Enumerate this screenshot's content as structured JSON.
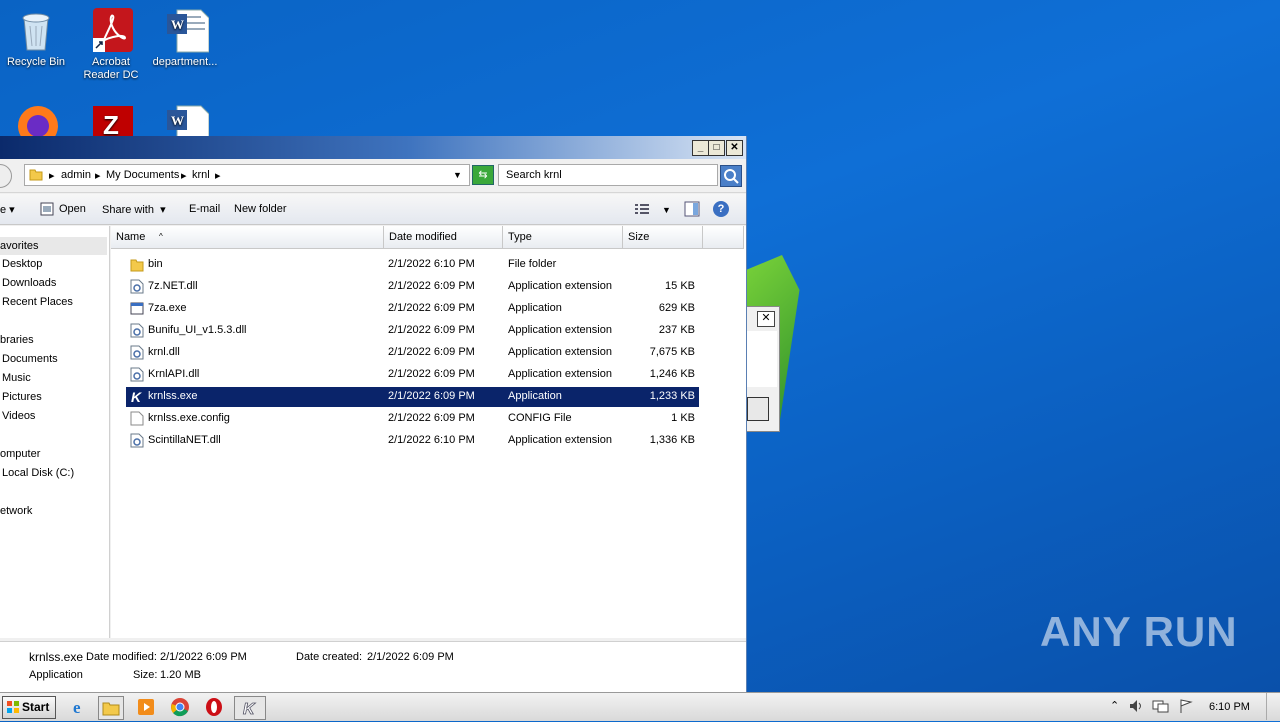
{
  "desktop": {
    "icons": [
      {
        "label": "Recycle Bin"
      },
      {
        "label": "Acrobat Reader DC"
      },
      {
        "label": "department..."
      },
      {
        "label": ""
      },
      {
        "label": ""
      },
      {
        "label": ""
      }
    ],
    "watermark": "ANY RUN"
  },
  "explorer": {
    "breadcrumb": [
      "admin",
      "My Documents",
      "krnl"
    ],
    "search_placeholder": "Search krnl",
    "toolbar": {
      "organize_label": "e",
      "open_label": "Open",
      "share_label": "Share with",
      "email_label": "E-mail",
      "new_folder_label": "New folder"
    },
    "nav": {
      "favorites": "avorites",
      "desktop": "Desktop",
      "downloads": "Downloads",
      "recent": "Recent Places",
      "libraries": "braries",
      "documents": "Documents",
      "music": "Music",
      "pictures": "Pictures",
      "videos": "Videos",
      "computer": "omputer",
      "local_disk": "Local Disk (C:)",
      "network": "etwork"
    },
    "columns": {
      "name": "Name",
      "date": "Date modified",
      "type": "Type",
      "size": "Size"
    },
    "files": [
      {
        "name": "bin",
        "date": "2/1/2022 6:10 PM",
        "type": "File folder",
        "size": "",
        "icon": "folder-icon"
      },
      {
        "name": "7z.NET.dll",
        "date": "2/1/2022 6:09 PM",
        "type": "Application extension",
        "size": "15 KB",
        "icon": "dll-icon"
      },
      {
        "name": "7za.exe",
        "date": "2/1/2022 6:09 PM",
        "type": "Application",
        "size": "629 KB",
        "icon": "exe-icon"
      },
      {
        "name": "Bunifu_UI_v1.5.3.dll",
        "date": "2/1/2022 6:09 PM",
        "type": "Application extension",
        "size": "237 KB",
        "icon": "dll-icon"
      },
      {
        "name": "krnl.dll",
        "date": "2/1/2022 6:09 PM",
        "type": "Application extension",
        "size": "7,675 KB",
        "icon": "dll-icon"
      },
      {
        "name": "KrnlAPI.dll",
        "date": "2/1/2022 6:09 PM",
        "type": "Application extension",
        "size": "1,246 KB",
        "icon": "dll-icon"
      },
      {
        "name": "krnlss.exe",
        "date": "2/1/2022 6:09 PM",
        "type": "Application",
        "size": "1,233 KB",
        "icon": "krnl-icon"
      },
      {
        "name": "krnlss.exe.config",
        "date": "2/1/2022 6:09 PM",
        "type": "CONFIG File",
        "size": "1 KB",
        "icon": "file-icon"
      },
      {
        "name": "ScintillaNET.dll",
        "date": "2/1/2022 6:10 PM",
        "type": "Application extension",
        "size": "1,336 KB",
        "icon": "dll-icon"
      }
    ],
    "details": {
      "name": "krnlss.exe",
      "modified_label": "Date modified:",
      "modified": "2/1/2022 6:09 PM",
      "created_label": "Date created:",
      "created": "2/1/2022 6:09 PM",
      "type": "Application",
      "size_label": "Size:",
      "size": "1.20 MB"
    }
  },
  "taskbar": {
    "start_label": "Start",
    "clock": "6:10 PM"
  }
}
